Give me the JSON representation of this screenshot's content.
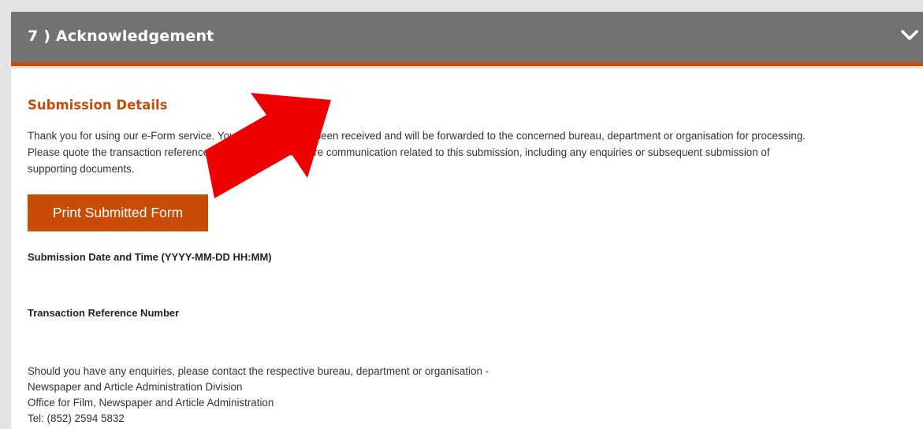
{
  "header": {
    "title": "7 ) Acknowledgement",
    "toggle_icon": "chevron-down-icon"
  },
  "details": {
    "heading": "Submission Details",
    "intro_lines": [
      "Thank you for using our e-Form service. Your application has been received and will be forwarded to the concerned bureau, department or organisation for processing.",
      "Please quote the transaction reference number below for future communication related to this submission, including any enquiries or subsequent submission of",
      "supporting documents."
    ],
    "print_button": "Print Submitted Form",
    "submission_datetime_label": "Submission Date and Time (YYYY-MM-DD HH:MM)",
    "transaction_ref_label": "Transaction Reference Number",
    "contact_lines": [
      "Should you have any enquiries, please contact the respective bureau, department or organisation -",
      "Newspaper and Article Administration Division",
      "Office for Film, Newspaper and Article Administration",
      "Tel: (852) 2594 5832"
    ]
  },
  "annotation": {
    "arrow_icon": "red-arrow-icon",
    "arrow_color": "#ee0000"
  },
  "colors": {
    "accent": "#c84b06",
    "header_bg": "#737373",
    "page_bg": "#e3e3e3"
  }
}
